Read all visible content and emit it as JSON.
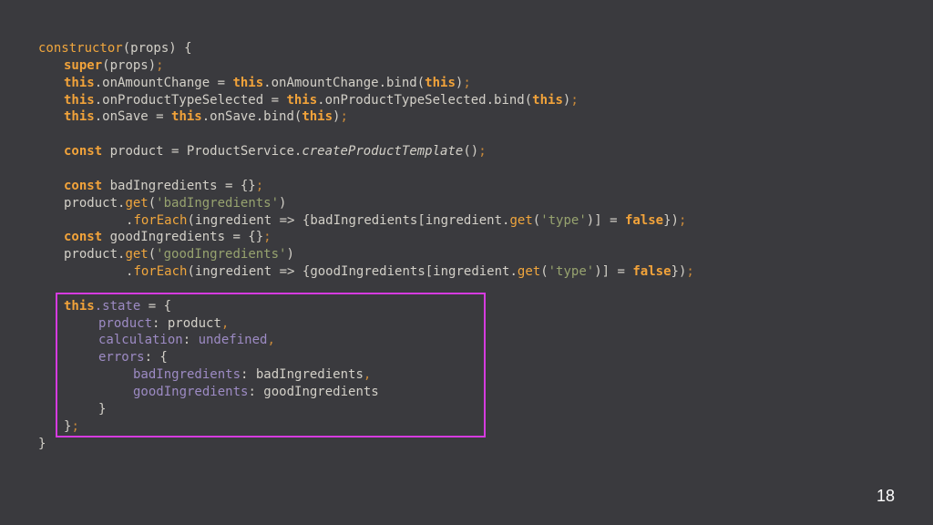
{
  "colors": {
    "background": "#3a3a3e",
    "default": "#d3d0c8",
    "keyword": "#f2a33a",
    "string": "#97a36f",
    "property": "#9d8bc4",
    "function": "#f0a63d",
    "punctuation": "#c98a3a",
    "highlight_border": "#d63be0"
  },
  "code_lines": [
    {
      "indent": 0,
      "tokens": [
        {
          "t": "constructor",
          "c": "function"
        },
        {
          "t": "(props) {",
          "c": "default"
        }
      ]
    },
    {
      "indent": 1,
      "tokens": [
        {
          "t": "super",
          "c": "keyword"
        },
        {
          "t": "(props)",
          "c": "default"
        },
        {
          "t": ";",
          "c": "punctuation"
        }
      ]
    },
    {
      "indent": 1,
      "tokens": [
        {
          "t": "this",
          "c": "keyword"
        },
        {
          "t": ".onAmountChange = ",
          "c": "default"
        },
        {
          "t": "this",
          "c": "keyword"
        },
        {
          "t": ".onAmountChange.bind(",
          "c": "default"
        },
        {
          "t": "this",
          "c": "keyword"
        },
        {
          "t": ")",
          "c": "default"
        },
        {
          "t": ";",
          "c": "punctuation"
        }
      ]
    },
    {
      "indent": 1,
      "tokens": [
        {
          "t": "this",
          "c": "keyword"
        },
        {
          "t": ".onProductTypeSelected = ",
          "c": "default"
        },
        {
          "t": "this",
          "c": "keyword"
        },
        {
          "t": ".onProductTypeSelected.bind(",
          "c": "default"
        },
        {
          "t": "this",
          "c": "keyword"
        },
        {
          "t": ")",
          "c": "default"
        },
        {
          "t": ";",
          "c": "punctuation"
        }
      ]
    },
    {
      "indent": 1,
      "tokens": [
        {
          "t": "this",
          "c": "keyword"
        },
        {
          "t": ".onSave = ",
          "c": "default"
        },
        {
          "t": "this",
          "c": "keyword"
        },
        {
          "t": ".onSave.bind(",
          "c": "default"
        },
        {
          "t": "this",
          "c": "keyword"
        },
        {
          "t": ")",
          "c": "default"
        },
        {
          "t": ";",
          "c": "punctuation"
        }
      ]
    },
    {
      "indent": 0,
      "tokens": []
    },
    {
      "indent": 1,
      "tokens": [
        {
          "t": "const",
          "c": "keyword"
        },
        {
          "t": " product = ProductService.",
          "c": "default"
        },
        {
          "t": "createProductTemplate",
          "c": "italic"
        },
        {
          "t": "()",
          "c": "default"
        },
        {
          "t": ";",
          "c": "punctuation"
        }
      ]
    },
    {
      "indent": 0,
      "tokens": []
    },
    {
      "indent": 1,
      "tokens": [
        {
          "t": "const",
          "c": "keyword"
        },
        {
          "t": " badIngredients = {}",
          "c": "default"
        },
        {
          "t": ";",
          "c": "punctuation"
        }
      ]
    },
    {
      "indent": 1,
      "tokens": [
        {
          "t": "product.",
          "c": "default"
        },
        {
          "t": "get",
          "c": "function"
        },
        {
          "t": "(",
          "c": "default"
        },
        {
          "t": "'badIngredients'",
          "c": "string"
        },
        {
          "t": ")",
          "c": "default"
        }
      ]
    },
    {
      "indent": 2,
      "tokens": [
        {
          "t": ".",
          "c": "default"
        },
        {
          "t": "forEach",
          "c": "function"
        },
        {
          "t": "(ingredient => {badIngredients[ingredient.",
          "c": "default"
        },
        {
          "t": "get",
          "c": "function"
        },
        {
          "t": "(",
          "c": "default"
        },
        {
          "t": "'type'",
          "c": "string"
        },
        {
          "t": ")] = ",
          "c": "default"
        },
        {
          "t": "false",
          "c": "keyword"
        },
        {
          "t": "})",
          "c": "default"
        },
        {
          "t": ";",
          "c": "punctuation"
        }
      ]
    },
    {
      "indent": 1,
      "tokens": [
        {
          "t": "const",
          "c": "keyword"
        },
        {
          "t": " goodIngredients = {}",
          "c": "default"
        },
        {
          "t": ";",
          "c": "punctuation"
        }
      ]
    },
    {
      "indent": 1,
      "tokens": [
        {
          "t": "product.",
          "c": "default"
        },
        {
          "t": "get",
          "c": "function"
        },
        {
          "t": "(",
          "c": "default"
        },
        {
          "t": "'goodIngredients'",
          "c": "string"
        },
        {
          "t": ")",
          "c": "default"
        }
      ]
    },
    {
      "indent": 2,
      "tokens": [
        {
          "t": ".",
          "c": "default"
        },
        {
          "t": "forEach",
          "c": "function"
        },
        {
          "t": "(ingredient => {goodIngredients[ingredient.",
          "c": "default"
        },
        {
          "t": "get",
          "c": "function"
        },
        {
          "t": "(",
          "c": "default"
        },
        {
          "t": "'type'",
          "c": "string"
        },
        {
          "t": ")] = ",
          "c": "default"
        },
        {
          "t": "false",
          "c": "keyword"
        },
        {
          "t": "})",
          "c": "default"
        },
        {
          "t": ";",
          "c": "punctuation"
        }
      ]
    },
    {
      "indent": 0,
      "tokens": []
    },
    {
      "indent": 1,
      "tokens": [
        {
          "t": "this",
          "c": "keyword"
        },
        {
          "t": ".state",
          "c": "property"
        },
        {
          "t": " = {",
          "c": "default"
        }
      ]
    },
    {
      "indent": 3,
      "tokens": [
        {
          "t": "product",
          "c": "property"
        },
        {
          "t": ": product",
          "c": "default"
        },
        {
          "t": ",",
          "c": "punctuation"
        }
      ]
    },
    {
      "indent": 3,
      "tokens": [
        {
          "t": "calculation",
          "c": "property"
        },
        {
          "t": ": ",
          "c": "default"
        },
        {
          "t": "undefined",
          "c": "property"
        },
        {
          "t": ",",
          "c": "punctuation"
        }
      ]
    },
    {
      "indent": 3,
      "tokens": [
        {
          "t": "errors",
          "c": "property"
        },
        {
          "t": ": {",
          "c": "default"
        }
      ]
    },
    {
      "indent": 4,
      "tokens": [
        {
          "t": "badIngredients",
          "c": "property"
        },
        {
          "t": ": badIngredients",
          "c": "default"
        },
        {
          "t": ",",
          "c": "punctuation"
        }
      ]
    },
    {
      "indent": 4,
      "tokens": [
        {
          "t": "goodIngredients",
          "c": "property"
        },
        {
          "t": ": goodIngredients",
          "c": "default"
        }
      ]
    },
    {
      "indent": 3,
      "tokens": [
        {
          "t": "}",
          "c": "default"
        }
      ]
    },
    {
      "indent": 1,
      "tokens": [
        {
          "t": "}",
          "c": "default"
        },
        {
          "t": ";",
          "c": "punctuation"
        }
      ]
    },
    {
      "indent": 0,
      "tokens": [
        {
          "t": "}",
          "c": "default"
        }
      ]
    }
  ],
  "page_number": "18"
}
